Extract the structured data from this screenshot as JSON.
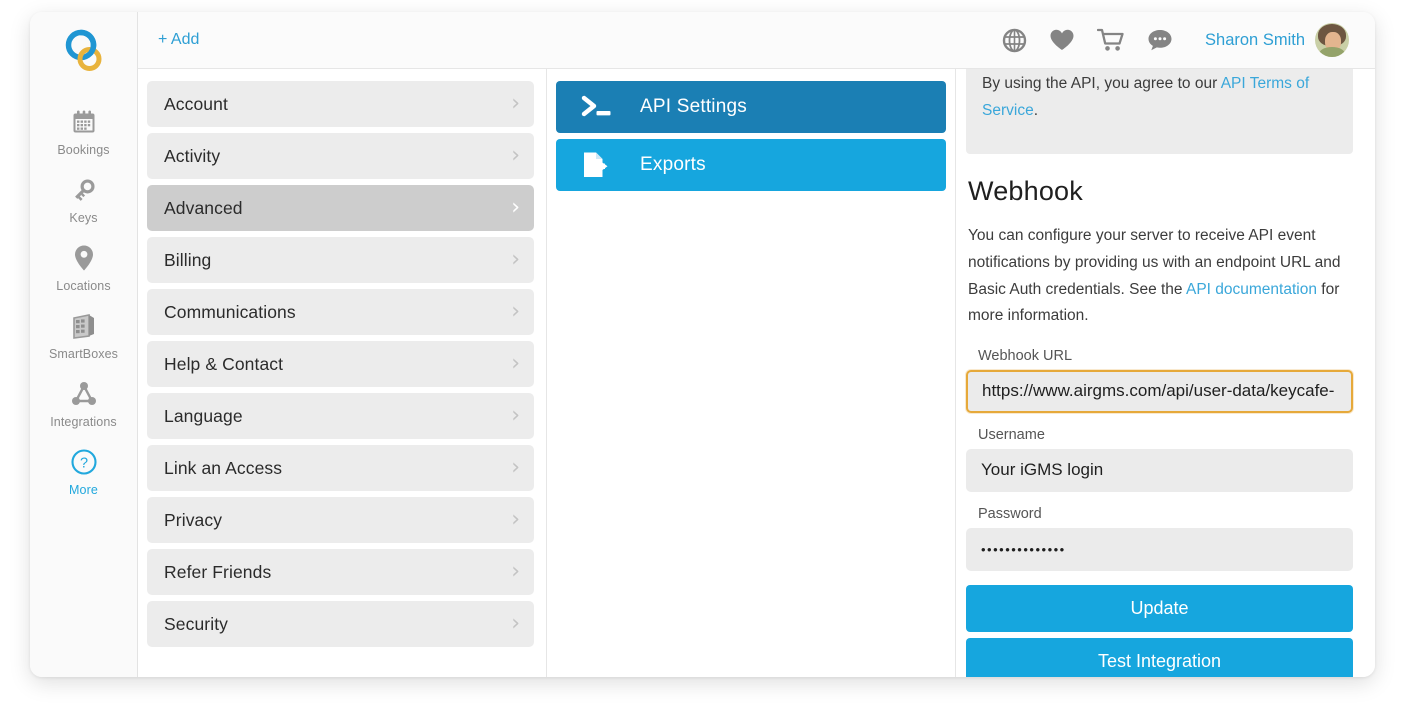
{
  "rail": {
    "logo_name": "keycafe-logo",
    "items": [
      {
        "label": "Bookings",
        "icon": "calendar-icon",
        "active": false
      },
      {
        "label": "Keys",
        "icon": "key-icon",
        "active": false
      },
      {
        "label": "Locations",
        "icon": "map-pin-icon",
        "active": false
      },
      {
        "label": "SmartBoxes",
        "icon": "smartbox-icon",
        "active": false
      },
      {
        "label": "Integrations",
        "icon": "integrations-icon",
        "active": false
      },
      {
        "label": "More",
        "icon": "question-circle-icon",
        "active": true
      }
    ]
  },
  "header": {
    "add_label": "+ Add",
    "icons": [
      "globe-icon",
      "heart-icon",
      "cart-icon",
      "chat-icon"
    ],
    "user_name": "Sharon Smith",
    "avatar_name": "user-avatar"
  },
  "settings_list": [
    {
      "label": "Account",
      "selected": false
    },
    {
      "label": "Activity",
      "selected": false
    },
    {
      "label": "Advanced",
      "selected": true
    },
    {
      "label": "Billing",
      "selected": false
    },
    {
      "label": "Communications",
      "selected": false
    },
    {
      "label": "Help & Contact",
      "selected": false
    },
    {
      "label": "Language",
      "selected": false
    },
    {
      "label": "Link an Access",
      "selected": false
    },
    {
      "label": "Privacy",
      "selected": false
    },
    {
      "label": "Refer Friends",
      "selected": false
    },
    {
      "label": "Security",
      "selected": false
    }
  ],
  "api_nav": [
    {
      "label": "API Settings",
      "icon": "terminal-icon",
      "color": "#1b7fb4"
    },
    {
      "label": "Exports",
      "icon": "file-export-icon",
      "color": "#16a6de"
    }
  ],
  "detail": {
    "terms": {
      "text_before": "By using the API, you agree to our ",
      "link_label": "API Terms of Service",
      "text_after": "."
    },
    "webhook_title": "Webhook",
    "webhook_desc_before": "You can configure your server to receive API event notifications by providing us with an endpoint URL and Basic Auth credentials. See the ",
    "webhook_desc_link": "API documentation",
    "webhook_desc_after": " for more information.",
    "fields": [
      {
        "label": "Webhook URL",
        "value": "https://www.airgms.com/api/user-data/keycafe-",
        "name": "webhook-url"
      },
      {
        "label": "Username",
        "value": "Your iGMS login",
        "name": "username"
      },
      {
        "label": "Password",
        "value": "••••••••••••••",
        "name": "password"
      }
    ],
    "buttons": [
      {
        "label": "Update",
        "name": "update-button"
      },
      {
        "label": "Test Integration",
        "name": "test-integration-button"
      }
    ]
  },
  "colors": {
    "accent_blue": "#16a6de",
    "dark_blue": "#1b7fb4",
    "link_blue": "#3aa7da",
    "highlight_orange": "#e6a93a",
    "row_grey": "#ececec",
    "row_selected_grey": "#cdcdcd"
  }
}
